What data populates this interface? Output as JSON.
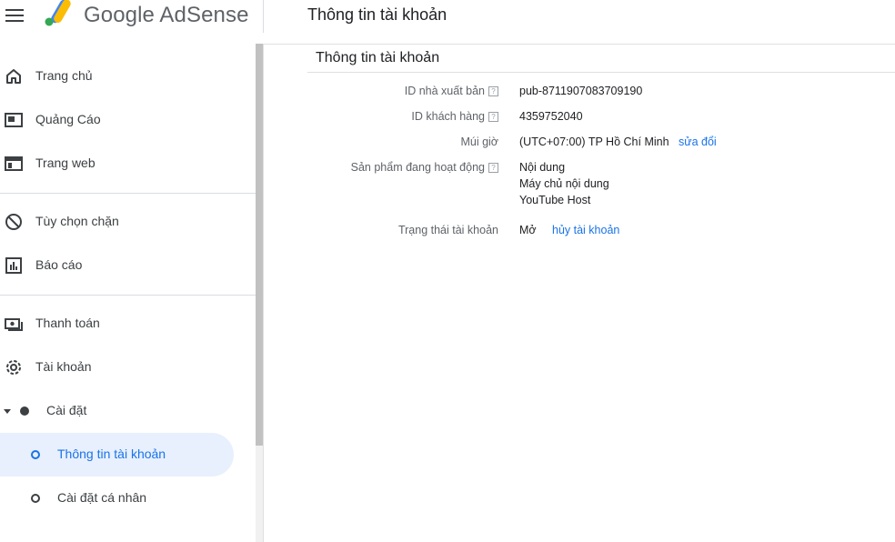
{
  "header": {
    "brand": "Google AdSense",
    "page_title": "Thông tin tài khoản"
  },
  "sidebar": {
    "items": [
      {
        "label": "Trang chủ",
        "icon": "home-icon"
      },
      {
        "label": "Quảng Cáo",
        "icon": "ads-icon"
      },
      {
        "label": "Trang web",
        "icon": "web-icon"
      },
      {
        "label": "Tùy chọn chặn",
        "icon": "block-icon"
      },
      {
        "label": "Báo cáo",
        "icon": "report-icon"
      },
      {
        "label": "Thanh toán",
        "icon": "payment-icon"
      },
      {
        "label": "Tài khoản",
        "icon": "gear-icon"
      }
    ],
    "settings": {
      "label": "Cài đặt",
      "children": [
        {
          "label": "Thông tin tài khoản",
          "active": true
        },
        {
          "label": "Cài đặt cá nhân",
          "active": false
        }
      ]
    }
  },
  "main": {
    "title": "Thông tin tài khoản",
    "rows": {
      "publisher_id": {
        "label": "ID nhà xuất bản",
        "value": "pub-8711907083709190"
      },
      "customer_id": {
        "label": "ID khách hàng",
        "value": "4359752040"
      },
      "timezone": {
        "label": "Múi giờ",
        "value": "(UTC+07:00) TP Hồ Chí Minh",
        "link": "sửa đổi"
      },
      "products": {
        "label": "Sản phẩm đang hoạt động",
        "values": [
          "Nội dung",
          "Máy chủ nội dung",
          "YouTube Host"
        ]
      },
      "status": {
        "label": "Trạng thái tài khoản",
        "value": "Mở",
        "link": "hủy tài khoản"
      }
    },
    "help_glyph": "?"
  },
  "colors": {
    "accent": "#1a73e8",
    "active_bg": "#e8f0fe",
    "text": "#202124",
    "muted": "#5f6368"
  }
}
